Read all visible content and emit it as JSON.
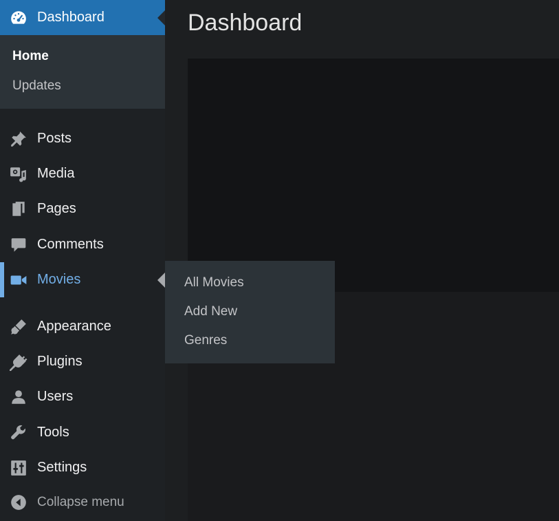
{
  "page": {
    "title": "Dashboard"
  },
  "colors": {
    "accent": "#2271b1",
    "active_link": "#72aee6",
    "sidebar_bg": "#1e2124",
    "submenu_bg": "#2c3338"
  },
  "sidebar": {
    "dashboard": {
      "label": "Dashboard",
      "icon": "dashboard-gauge-icon",
      "submenu": [
        {
          "label": "Home",
          "current": true
        },
        {
          "label": "Updates",
          "current": false
        }
      ]
    },
    "items": [
      {
        "key": "posts",
        "label": "Posts",
        "icon": "pushpin-icon"
      },
      {
        "key": "media",
        "label": "Media",
        "icon": "media-icon"
      },
      {
        "key": "pages",
        "label": "Pages",
        "icon": "pages-icon"
      },
      {
        "key": "comments",
        "label": "Comments",
        "icon": "comment-bubble-icon"
      },
      {
        "key": "movies",
        "label": "Movies",
        "icon": "video-camera-icon",
        "active": true
      },
      {
        "key": "appearance",
        "label": "Appearance",
        "icon": "paintbrush-icon"
      },
      {
        "key": "plugins",
        "label": "Plugins",
        "icon": "plug-icon"
      },
      {
        "key": "users",
        "label": "Users",
        "icon": "user-icon"
      },
      {
        "key": "tools",
        "label": "Tools",
        "icon": "wrench-icon"
      },
      {
        "key": "settings",
        "label": "Settings",
        "icon": "sliders-icon"
      }
    ],
    "collapse": {
      "label": "Collapse menu",
      "icon": "collapse-arrow-icon"
    }
  },
  "flyout": {
    "items": [
      {
        "label": "All Movies"
      },
      {
        "label": "Add New"
      },
      {
        "label": "Genres"
      }
    ]
  }
}
